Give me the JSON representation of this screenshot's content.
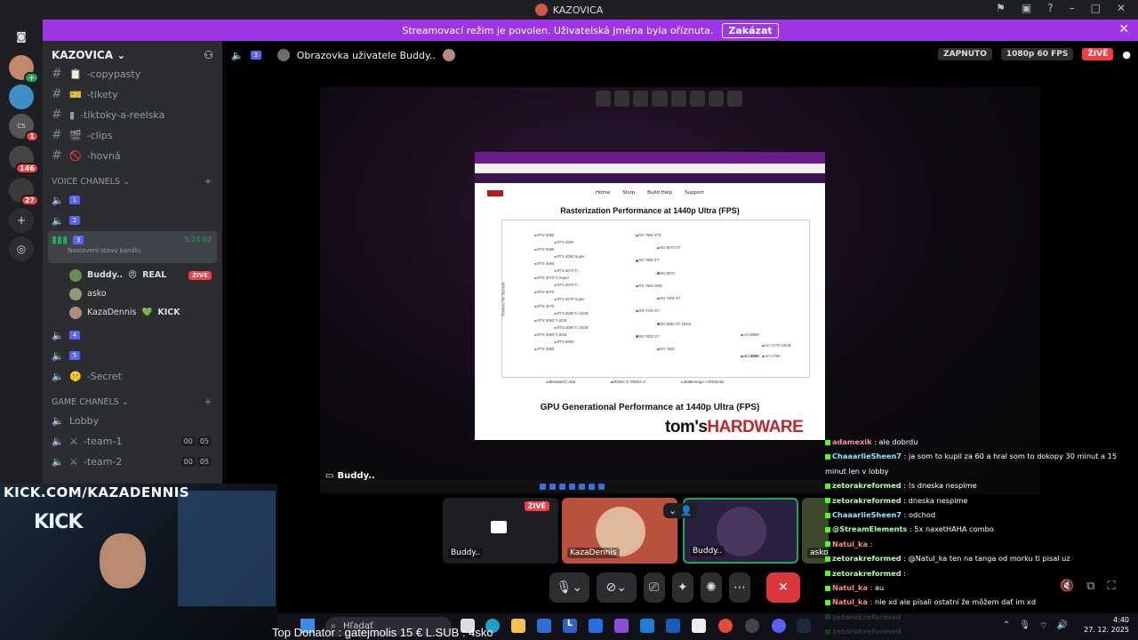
{
  "window": {
    "title": "KAZOVICA"
  },
  "banner": {
    "text": "Streamovací režim je povolen. Uživatelská jména byla oříznuta.",
    "button": "Zakázat"
  },
  "rail": {
    "badges": [
      "1",
      "146",
      "27"
    ]
  },
  "server": {
    "name": "KAZOVICA"
  },
  "text_channels": [
    "-copypasty",
    "-tikety",
    "-tiktoky-a-reelska",
    "-clips",
    "-hovná"
  ],
  "voice_category": "VOICE CHANELS",
  "voice_channels": [
    {
      "num": "1"
    },
    {
      "num": "2"
    },
    {
      "num": "3",
      "time": "5:24:03",
      "status": "Nastavení stavu kanálu"
    }
  ],
  "voice_users": [
    {
      "name": "Buddy..",
      "tag": "REAL",
      "live": "ŽIVĚ"
    },
    {
      "name": "asko"
    },
    {
      "name": "KazaDennis",
      "tag": "KICK"
    }
  ],
  "voice_channels2": [
    {
      "num": "4"
    },
    {
      "num": "5"
    },
    {
      "name": "-Secret"
    }
  ],
  "game_category": "GAME CHANELS",
  "game_channels": [
    {
      "name": "Lobby"
    },
    {
      "name": "-team-1",
      "a": "00",
      "b": "05"
    },
    {
      "name": "-team-2",
      "a": "00",
      "b": "05"
    }
  ],
  "stage": {
    "channel_num": "3",
    "title": "Obrazovka uživatele Buddy..",
    "zapnuto": "ZAPNUTO",
    "quality": "1080p 60 FPS",
    "live": "ŽIVĚ",
    "stream_label": "Buddy.."
  },
  "browser": {
    "nav": [
      "Home",
      "Shop",
      "Build Help",
      "Support"
    ],
    "chart1_title": "Rasterization Performance at 1440p Ultra (FPS)",
    "chart2_title": "GPU Generational Performance at 1440p Ultra (FPS)",
    "brand": "tom'sHARDWARE",
    "legend": [
      "Blackwell / Ada",
      "RDNA 4 / RDNA 3",
      "Battlemage / Alchemist"
    ]
  },
  "chart_data": {
    "type": "scatter",
    "title": "Rasterization Performance at 1440p Ultra (FPS)",
    "ylabel": "Frames Per Second",
    "groups": [
      "Blackwell / Ada",
      "RDNA 4 / RDNA 3",
      "Battlemage / Alchemist"
    ],
    "points": [
      {
        "label": "RTX 5090",
        "group": "Blackwell / Ada"
      },
      {
        "label": "RTX 4090",
        "group": "Blackwell / Ada"
      },
      {
        "label": "RTX 5080",
        "group": "Blackwell / Ada"
      },
      {
        "label": "RTX 4080 Super",
        "group": "Blackwell / Ada"
      },
      {
        "label": "RTX 4080",
        "group": "Blackwell / Ada"
      },
      {
        "label": "RTX 5070 Ti",
        "group": "Blackwell / Ada"
      },
      {
        "label": "RTX 4070 Ti Super",
        "group": "Blackwell / Ada"
      },
      {
        "label": "RTX 4070 Ti",
        "group": "Blackwell / Ada"
      },
      {
        "label": "RTX 5070",
        "group": "Blackwell / Ada"
      },
      {
        "label": "RTX 4070 Super",
        "group": "Blackwell / Ada"
      },
      {
        "label": "RTX 4070",
        "group": "Blackwell / Ada"
      },
      {
        "label": "RTX 5060 Ti 16GB",
        "group": "Blackwell / Ada"
      },
      {
        "label": "RTX 5060 Ti 8GB",
        "group": "Blackwell / Ada"
      },
      {
        "label": "RTX 4060 Ti 16GB",
        "group": "Blackwell / Ada"
      },
      {
        "label": "RTX 4060 Ti 8GB",
        "group": "Blackwell / Ada"
      },
      {
        "label": "RTX 5060",
        "group": "Blackwell / Ada"
      },
      {
        "label": "RTX 4060",
        "group": "Blackwell / Ada"
      },
      {
        "label": "RX 7900 XTX",
        "group": "RDNA 4 / RDNA 3"
      },
      {
        "label": "RX 9070 XT",
        "group": "RDNA 4 / RDNA 3"
      },
      {
        "label": "RX 7900 XT",
        "group": "RDNA 4 / RDNA 3"
      },
      {
        "label": "RX 9070",
        "group": "RDNA 4 / RDNA 3"
      },
      {
        "label": "RX 7900 GRE",
        "group": "RDNA 4 / RDNA 3"
      },
      {
        "label": "RX 7800 XT",
        "group": "RDNA 4 / RDNA 3"
      },
      {
        "label": "RX 7700 XT",
        "group": "RDNA 4 / RDNA 3"
      },
      {
        "label": "RX 9060 XT 16GB",
        "group": "RDNA 4 / RDNA 3"
      },
      {
        "label": "RX 7600 XT",
        "group": "RDNA 4 / RDNA 3"
      },
      {
        "label": "RX 7600",
        "group": "RDNA 4 / RDNA 3"
      },
      {
        "label": "Arc B580",
        "group": "Battlemage / Alchemist"
      },
      {
        "label": "Arc A770 16GB",
        "group": "Battlemage / Alchemist"
      },
      {
        "label": "Arc B570",
        "group": "Battlemage / Alchemist"
      },
      {
        "label": "Arc A750",
        "group": "Battlemage / Alchemist"
      },
      {
        "label": "Arc A580",
        "group": "Battlemage / Alchemist"
      }
    ]
  },
  "tiles": [
    {
      "name": "Buddy..",
      "live": "ŽIVĚ"
    },
    {
      "name": "KazaDennis"
    },
    {
      "name": "Buddy.."
    },
    {
      "name": "asko"
    }
  ],
  "overlay": {
    "kick_url": "KICK.COM/KAZADENNIS",
    "kick_sign": "KICK",
    "top_donator": "Top Donator : gatejmolis 15 €   L.SUB : 4sko"
  },
  "chat": [
    {
      "nick": "adamexik",
      "text": "ale dobrdu",
      "color": "#f48fb1"
    },
    {
      "nick": "ChaaarlieSheen7",
      "text": "ja som to kupil za 60 a hral som to dokopy 30 minut a 15 minut len v lobby",
      "color": "#8be9fd"
    },
    {
      "nick": "zetorakreformed",
      "text": "!s dneska nespime",
      "color": "#b0ffb0"
    },
    {
      "nick": "zetorakreformed",
      "text": "dneska nespime",
      "color": "#b0ffb0"
    },
    {
      "nick": "ChaaarlieSheen7",
      "text": "odchod",
      "color": "#8be9fd"
    },
    {
      "nick": "@StreamElements",
      "text": "5x naxetHAHA combo",
      "color": "#b0ffb0"
    },
    {
      "nick": "Natul_ka",
      "text": "",
      "color": "#ff8a80"
    },
    {
      "nick": "zetorakreformed",
      "text": "@Natul_ka ten na tanga od morku ti pisal uz",
      "color": "#b0ffb0"
    },
    {
      "nick": "zetorakreformed",
      "text": "",
      "color": "#b0ffb0"
    },
    {
      "nick": "Natul_ka",
      "text": "au",
      "color": "#ff8a80"
    },
    {
      "nick": "Natul_ka",
      "text": "nie xd ale písali ostatní že môžem dať im xd",
      "color": "#ff8a80"
    },
    {
      "nick": "zetorakreformed",
      "text": "",
      "color": "#b0ffb0"
    },
    {
      "nick": "zetorakreformed",
      "text": "",
      "color": "#b0ffb0"
    }
  ],
  "taskbar": {
    "search": "Hľadať",
    "time": "4:40",
    "date": "27. 12. 2025"
  }
}
